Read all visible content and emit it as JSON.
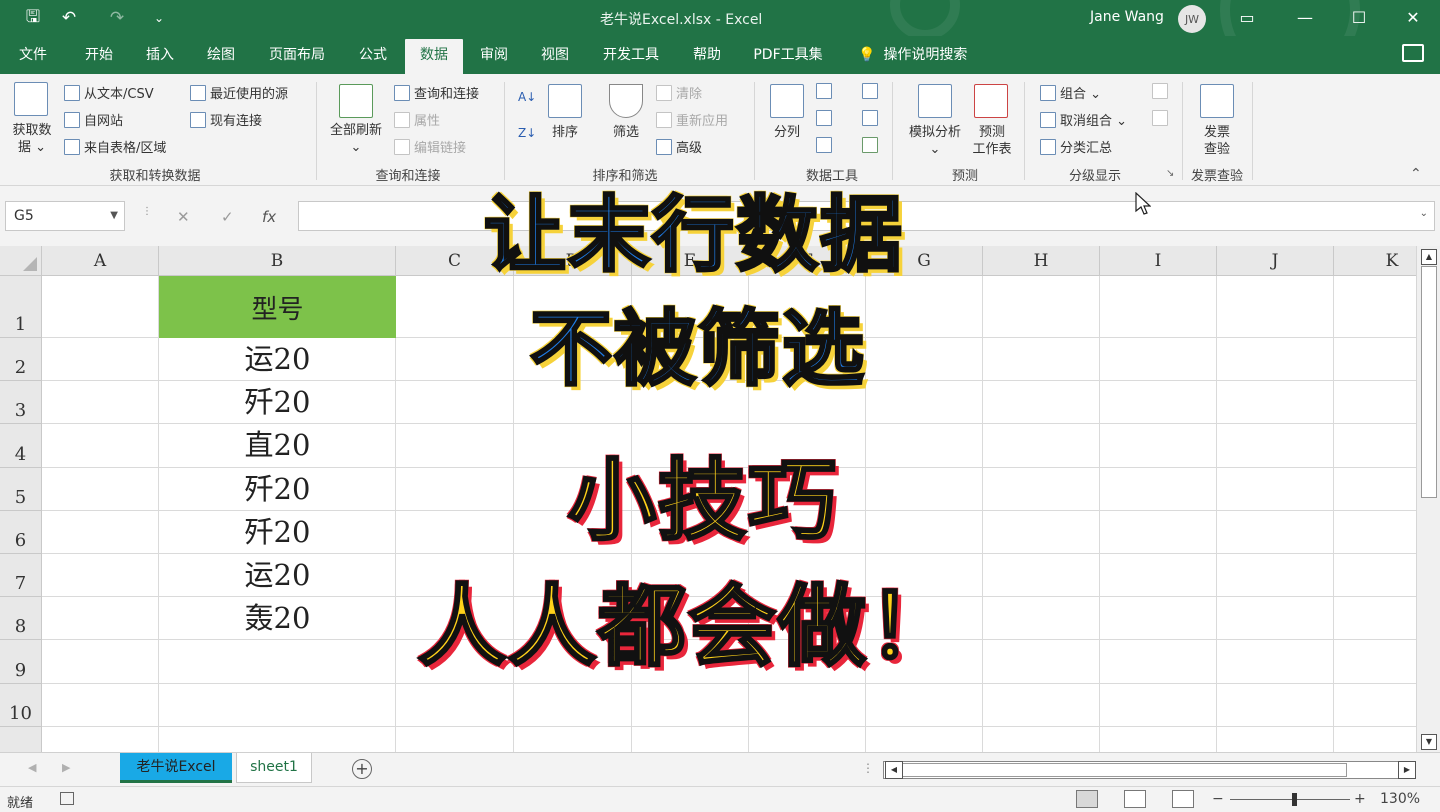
{
  "titlebar": {
    "title": "老牛说Excel.xlsx  -  Excel",
    "user": "Jane Wang",
    "avatar_initials": "JW",
    "qat": {
      "save": "🖫",
      "undo": "↶",
      "redo": "↷",
      "customize": "⌄"
    },
    "window": {
      "ribbon_options": "▭",
      "minimize": "—",
      "maximize": "☐",
      "close": "✕"
    }
  },
  "menu": {
    "tabs": [
      "文件",
      "开始",
      "插入",
      "绘图",
      "页面布局",
      "公式",
      "数据",
      "审阅",
      "视图",
      "开发工具",
      "帮助",
      "PDF工具集"
    ],
    "active": "数据",
    "tell_me": "操作说明搜索",
    "tell_me_icon": "lightbulb-icon"
  },
  "ribbon": {
    "get_data": "获取数\n据 ⌄",
    "from_text_csv": "从文本/CSV",
    "from_web": "自网站",
    "from_table": "来自表格/区域",
    "recent_sources": "最近使用的源",
    "existing_connections": "现有连接",
    "group_get_transform": "获取和转换数据",
    "refresh_all": "全部刷新\n⌄",
    "queries_connections": "查询和连接",
    "properties": "属性",
    "edit_links": "编辑链接",
    "group_queries": "查询和连接",
    "sort": "排序",
    "filter": "筛选",
    "clear": "清除",
    "reapply": "重新应用",
    "advanced": "高级",
    "group_sort_filter": "排序和筛选",
    "text_to_columns": "分列",
    "group_data_tools": "数据工具",
    "what_if": "模拟分析\n⌄",
    "forecast_sheet": "预测\n工作表",
    "group_forecast": "预测",
    "group_outline_items": {
      "group": "组合  ⌄",
      "ungroup": "取消组合  ⌄",
      "subtotal": "分类汇总"
    },
    "group_outline": "分级显示",
    "invoice_check": "发票\n查验",
    "group_invoice": "发票查验"
  },
  "formula_bar": {
    "name_box": "G5",
    "cancel": "✕",
    "enter": "✓",
    "fx": "fx",
    "value": ""
  },
  "sheet": {
    "columns": [
      "A",
      "B",
      "C",
      "D",
      "E",
      "F",
      "G",
      "H",
      "I",
      "J",
      "K"
    ],
    "rows": [
      "1",
      "2",
      "3",
      "4",
      "5",
      "6",
      "7",
      "8",
      "9",
      "10"
    ],
    "header_cell": "型号",
    "values": [
      "运20",
      "歼20",
      "直20",
      "歼20",
      "歼20",
      "运20",
      "轰20"
    ]
  },
  "overlay": {
    "line1": "让末行数据",
    "line2": "不被筛选",
    "line3": "小技巧",
    "line4": "人人都会做！"
  },
  "sheet_tabs": {
    "tabs": [
      "老牛说Excel",
      "sheet1"
    ],
    "active": "老牛说Excel",
    "add": "+",
    "prev": "◀",
    "next": "▶"
  },
  "status": {
    "ready": "就绪",
    "zoom": "130%",
    "zoom_out": "−",
    "zoom_in": "+"
  },
  "colors": {
    "excel_green": "#217346",
    "header_fill": "#7dc24a",
    "active_sheet_tab": "#19a9e6",
    "overlay_blue": "#1f7de8",
    "overlay_yellow": "#ffd21a"
  }
}
